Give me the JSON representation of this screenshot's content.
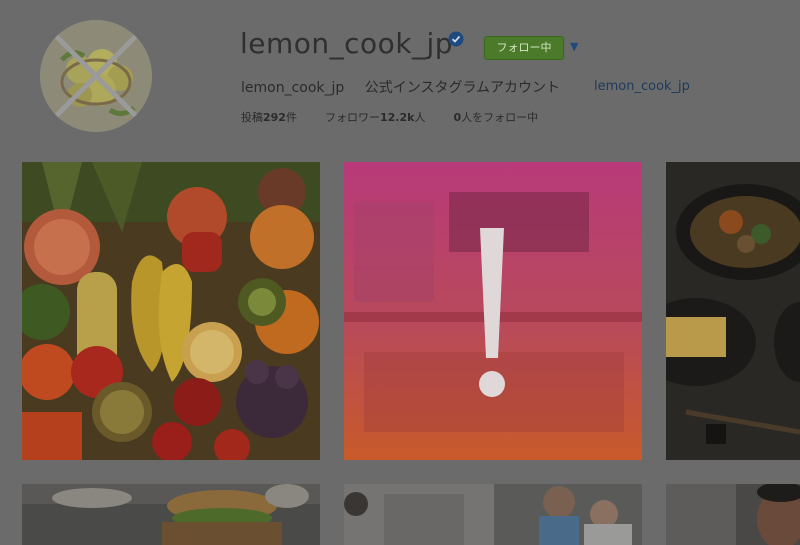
{
  "profile": {
    "username": "lemon_cook_jp",
    "verified_icon": "verified-badge-icon",
    "follow_button": "フォロー中",
    "dropdown_icon": "chevron-down-icon",
    "fullname": "lemon_cook_jp",
    "description": "公式インスタグラムアカウント",
    "link": "lemon_cook_jp",
    "stats": {
      "posts_label": "投稿",
      "posts_count": "292",
      "posts_unit": "件",
      "followers_label": "フォロワー",
      "followers_count": "12.2k",
      "followers_unit": "人",
      "following_count": "0",
      "following_label": "人をフォロー中"
    }
  },
  "posts": [
    {
      "name": "fruits-vegetables-photo"
    },
    {
      "name": "cafe-photo-warning"
    },
    {
      "name": "bowl-food-photo"
    },
    {
      "name": "burger-hands-photo"
    },
    {
      "name": "kitchen-people-photo"
    },
    {
      "name": "chef-photo"
    }
  ],
  "colors": {
    "overlay": "#6b6b6b",
    "follow_button_bg": "#4a7a2a",
    "link": "#1d3a5c",
    "warning_gradient_top": "#c0407a",
    "warning_gradient_bottom": "#d45a2a"
  }
}
